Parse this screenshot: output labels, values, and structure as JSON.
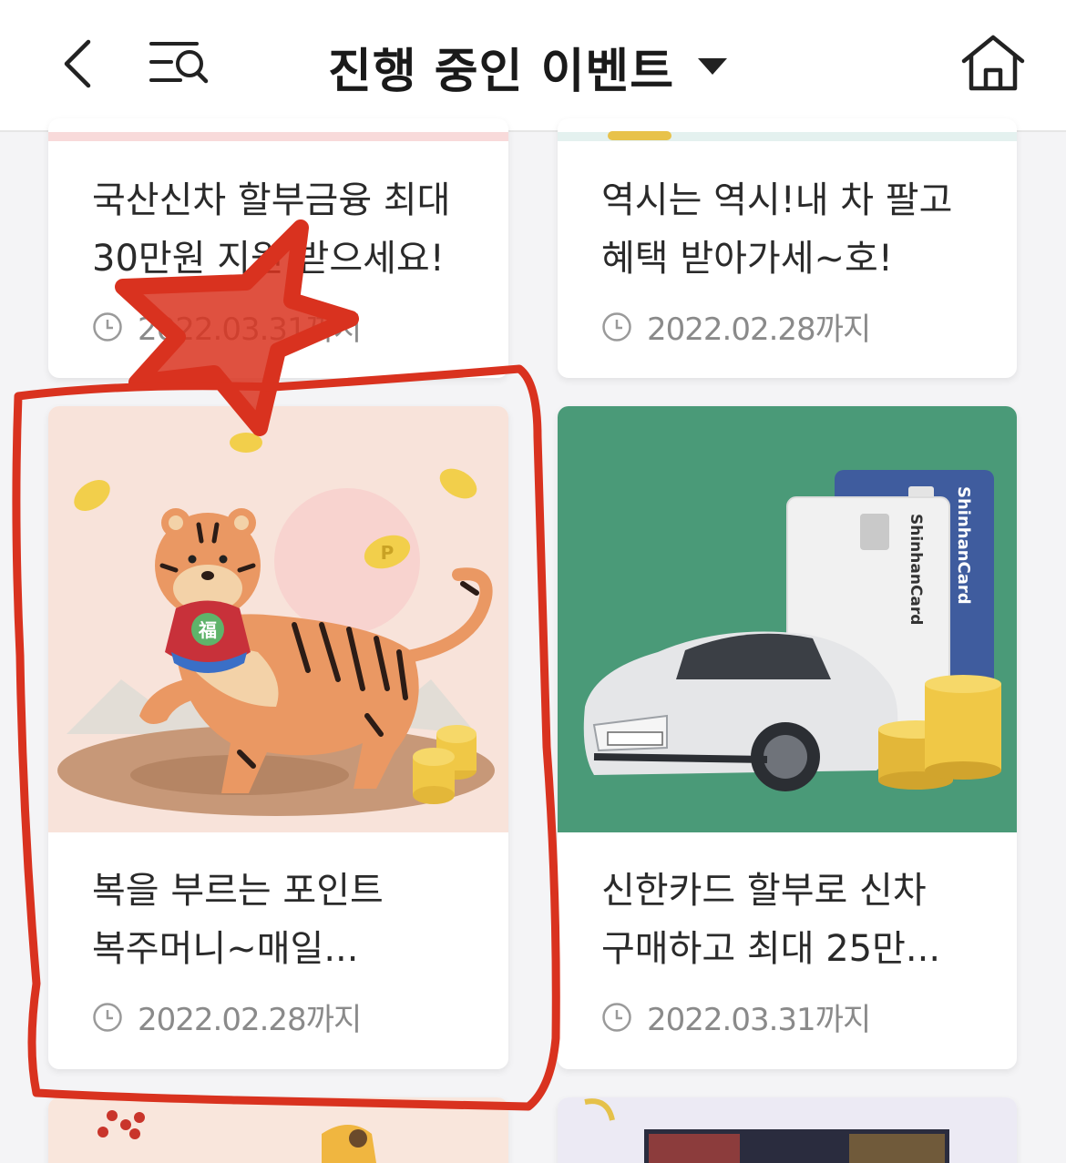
{
  "header": {
    "title": "진행 중인 이벤트",
    "icons": {
      "back": "chevron-left-icon",
      "search_menu": "list-search-icon",
      "dropdown": "caret-down-icon",
      "home": "home-icon"
    }
  },
  "cards": [
    {
      "title_line1": "국산신차 할부금융 최대",
      "title_line2": "30만원 지원 받으세요!",
      "date": "2022.03.31까지"
    },
    {
      "title_line1": "역시는 역시!내 차 팔고",
      "title_line2": "혜택 받아가세~호!",
      "date": "2022.02.28까지"
    },
    {
      "title_line1": "복을 부르는 포인트",
      "title_line2": "복주머니~매일...",
      "date": "2022.02.28까지",
      "pouch_char": "福"
    },
    {
      "title_line1": "신한카드 할부로 신차",
      "title_line2": "구매하고 최대 25만...",
      "date": "2022.03.31까지",
      "card_brand": "ShinhanCard"
    }
  ],
  "colors": {
    "annotation_red": "#d9321f",
    "green_banner": "#4a9a78",
    "peach_banner": "#f8e3da"
  }
}
